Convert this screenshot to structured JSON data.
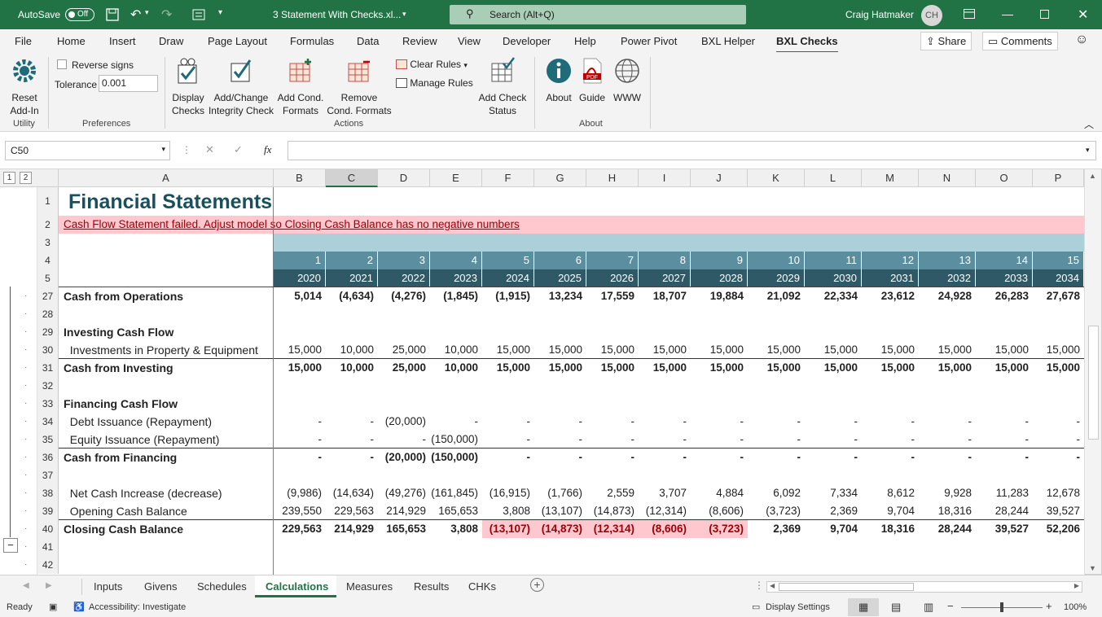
{
  "titlebar": {
    "autosave": "AutoSave",
    "autosave_state": "Off",
    "filename": "3 Statement With Checks.xl...",
    "search": "Search (Alt+Q)",
    "user": "Craig Hatmaker",
    "initials": "CH"
  },
  "ribbon_tabs": [
    "File",
    "Home",
    "Insert",
    "Draw",
    "Page Layout",
    "Formulas",
    "Data",
    "Review",
    "View",
    "Developer",
    "Help",
    "Power Pivot",
    "BXL Helper",
    "BXL Checks"
  ],
  "active_tab": "BXL Checks",
  "share": "Share",
  "comments": "Comments",
  "ribbon": {
    "reset": [
      "Reset",
      "Add-In"
    ],
    "reverse_signs": "Reverse signs",
    "tolerance_label": "Tolerance",
    "tolerance_value": "0.001",
    "display": [
      "Display",
      "Checks"
    ],
    "addchange": [
      "Add/Change",
      "Integrity Check"
    ],
    "addcond": [
      "Add Cond.",
      "Formats"
    ],
    "removecond": [
      "Remove",
      "Cond. Formats"
    ],
    "clear_rules": "Clear Rules",
    "manage_rules": "Manage Rules",
    "addcheck": [
      "Add Check",
      "Status"
    ],
    "about": "About",
    "guide": "Guide",
    "www": "WWW",
    "groups": {
      "utility": "Utility",
      "preferences": "Preferences",
      "actions": "Actions",
      "about": "About"
    }
  },
  "namebox": "C50",
  "sheet": {
    "columns": [
      "A",
      "B",
      "C",
      "D",
      "E",
      "F",
      "G",
      "H",
      "I",
      "J",
      "K",
      "L",
      "M",
      "N",
      "O",
      "P"
    ],
    "title": "Financial Statements",
    "warning": "Cash Flow Statement failed. Adjust model so  Closing Cash Balance  has no negative numbers",
    "periods": [
      "1",
      "2",
      "3",
      "4",
      "5",
      "6",
      "7",
      "8",
      "9",
      "10",
      "11",
      "12",
      "13",
      "14",
      "15"
    ],
    "years": [
      "2020",
      "2021",
      "2022",
      "2023",
      "2024",
      "2025",
      "2026",
      "2027",
      "2028",
      "2029",
      "2030",
      "2031",
      "2032",
      "2033",
      "2034"
    ],
    "rows": [
      {
        "n": "27",
        "label": "Cash from Operations",
        "bold": true,
        "values": [
          "5,014",
          "(4,634)",
          "(4,276)",
          "(1,845)",
          "(1,915)",
          "13,234",
          "17,559",
          "18,707",
          "19,884",
          "21,092",
          "22,334",
          "23,612",
          "24,928",
          "26,283",
          "27,678"
        ]
      },
      {
        "n": "28",
        "label": "",
        "values": []
      },
      {
        "n": "29",
        "label": "Investing Cash Flow",
        "bold": true,
        "values": []
      },
      {
        "n": "30",
        "label": "  Investments in Property & Equipment",
        "values": [
          "15,000",
          "10,000",
          "25,000",
          "10,000",
          "15,000",
          "15,000",
          "15,000",
          "15,000",
          "15,000",
          "15,000",
          "15,000",
          "15,000",
          "15,000",
          "15,000",
          "15,000"
        ]
      },
      {
        "n": "31",
        "label": "Cash from Investing",
        "bold": true,
        "topline": true,
        "values": [
          "15,000",
          "10,000",
          "25,000",
          "10,000",
          "15,000",
          "15,000",
          "15,000",
          "15,000",
          "15,000",
          "15,000",
          "15,000",
          "15,000",
          "15,000",
          "15,000",
          "15,000"
        ]
      },
      {
        "n": "32",
        "label": "",
        "values": []
      },
      {
        "n": "33",
        "label": "Financing Cash Flow",
        "bold": true,
        "values": []
      },
      {
        "n": "34",
        "label": "  Debt Issuance (Repayment)",
        "values": [
          "-",
          "-",
          "(20,000)",
          "-",
          "-",
          "-",
          "-",
          "-",
          "-",
          "-",
          "-",
          "-",
          "-",
          "-",
          "-"
        ]
      },
      {
        "n": "35",
        "label": "  Equity Issuance (Repayment)",
        "values": [
          "-",
          "-",
          "-",
          "(150,000)",
          "-",
          "-",
          "-",
          "-",
          "-",
          "-",
          "-",
          "-",
          "-",
          "-",
          "-"
        ]
      },
      {
        "n": "36",
        "label": "Cash from Financing",
        "bold": true,
        "topline": true,
        "values": [
          "-",
          "-",
          "(20,000)",
          "(150,000)",
          "-",
          "-",
          "-",
          "-",
          "-",
          "-",
          "-",
          "-",
          "-",
          "-",
          "-"
        ]
      },
      {
        "n": "37",
        "label": "",
        "values": []
      },
      {
        "n": "38",
        "label": "  Net Cash Increase (decrease)",
        "values": [
          "(9,986)",
          "(14,634)",
          "(49,276)",
          "(161,845)",
          "(16,915)",
          "(1,766)",
          "2,559",
          "3,707",
          "4,884",
          "6,092",
          "7,334",
          "8,612",
          "9,928",
          "11,283",
          "12,678"
        ]
      },
      {
        "n": "39",
        "label": "  Opening Cash Balance",
        "values": [
          "239,550",
          "229,563",
          "214,929",
          "165,653",
          "3,808",
          "(13,107)",
          "(14,873)",
          "(12,314)",
          "(8,606)",
          "(3,723)",
          "2,369",
          "9,704",
          "18,316",
          "28,244",
          "39,527"
        ]
      },
      {
        "n": "40",
        "label": "Closing Cash Balance",
        "bold": true,
        "topline": true,
        "neg_highlight": true,
        "values": [
          "229,563",
          "214,929",
          "165,653",
          "3,808",
          "(13,107)",
          "(14,873)",
          "(12,314)",
          "(8,606)",
          "(3,723)",
          "2,369",
          "9,704",
          "18,316",
          "28,244",
          "39,527",
          "52,206"
        ]
      },
      {
        "n": "41",
        "label": "",
        "values": []
      },
      {
        "n": "42",
        "label": "",
        "values": []
      }
    ]
  },
  "sheet_tabs": [
    "Inputs",
    "Givens",
    "Schedules",
    "Calculations",
    "Measures",
    "Results",
    "CHKs"
  ],
  "active_sheet": "Calculations",
  "status": {
    "ready": "Ready",
    "accessibility": "Accessibility: Investigate",
    "display": "Display Settings",
    "zoom": "100%"
  }
}
